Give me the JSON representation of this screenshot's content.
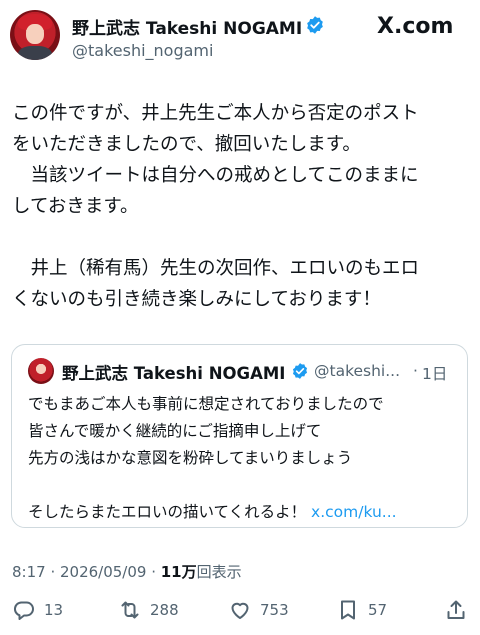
{
  "author": {
    "name": "野上武志 Takeshi NOGAMI",
    "handle": "@takeshi_nogami"
  },
  "brand": "X.com",
  "tweet": {
    "lines": [
      "この件ですが、井上先生ご本人から否定のポスト",
      "をいただきましたので、撤回いたします。",
      "　当該ツイートは自分への戒めとしてこのままに",
      "しておきます。",
      "",
      "　井上（稀有馬）先生の次回作、エロいのもエロ",
      "くないのも引き続き楽しみにしております！"
    ]
  },
  "quote": {
    "name": "野上武志 Takeshi NOGAMI",
    "handle": "@takeshi...",
    "time": "1日",
    "lines": [
      "でもまあご本人も事前に想定されておりましたので",
      "皆さんで暖かく継続的にご指摘申し上げて",
      "先方の浅はかな意図を粉砕してまいりましょう",
      "",
      "そしたらまたエロいの描いてくれるよ！"
    ],
    "link": "x.com/ku..."
  },
  "meta": {
    "time": "8:17 · 2026/05/09 · ",
    "views_count": "11万",
    "views_label": "回表示"
  },
  "actions": {
    "replies": "13",
    "reposts": "288",
    "likes": "753",
    "bookmarks": "57"
  },
  "colors": {
    "link": "#1d9bf0",
    "verified": "#1d9bf0",
    "secondary_text": "#536471"
  }
}
